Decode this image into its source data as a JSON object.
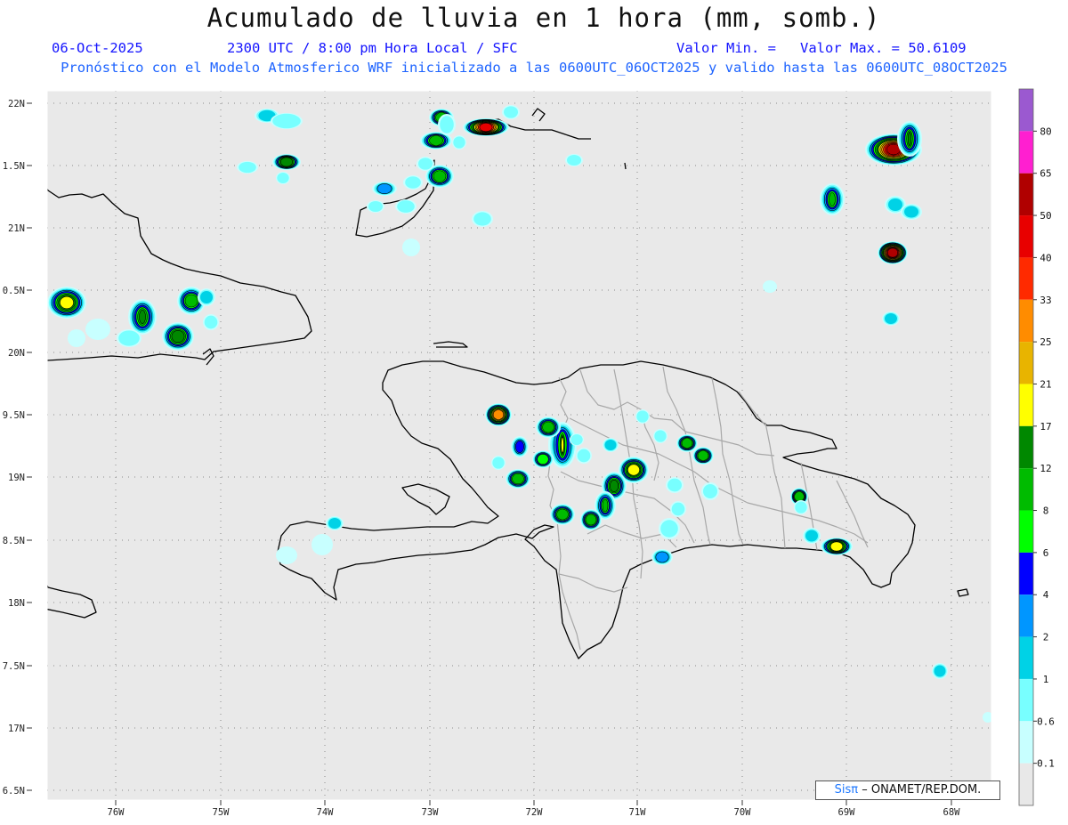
{
  "header": {
    "title": "Acumulado de lluvia en 1 hora (mm, somb.)",
    "date": "06-Oct-2025",
    "time_line": "2300 UTC / 8:00 pm Hora Local / SFC",
    "valor_min": "Valor Min. =",
    "valor_max": "Valor Max. = 50.6109",
    "model_line": "Pronóstico con el Modelo Atmosferico WRF inicializado a las 0600UTC_06OCT2025 y valido hasta las  0600UTC_08OCT2025"
  },
  "axes": {
    "lat_labels": [
      "22N",
      "1.5N",
      "21N",
      "0.5N",
      "20N",
      "9.5N",
      "19N",
      "8.5N",
      "18N",
      "7.5N",
      "17N",
      "6.5N"
    ],
    "lon_labels": [
      "76W",
      "75W",
      "74W",
      "73W",
      "72W",
      "71W",
      "70W",
      "69W",
      "68W"
    ]
  },
  "colorbar": {
    "labels": [
      "80",
      "65",
      "50",
      "40",
      "33",
      "25",
      "21",
      "17",
      "12",
      "8",
      "6",
      "4",
      "2",
      "1",
      "0.6",
      "0.1"
    ],
    "colors": [
      "#9b59d0",
      "#ff1fd0",
      "#b00000",
      "#e80000",
      "#ff2a00",
      "#ff8c00",
      "#e8b400",
      "#ffff00",
      "#008800",
      "#00bb00",
      "#00ff00",
      "#0000ff",
      "#0096ff",
      "#00d2e6",
      "#78ffff",
      "#c8ffff",
      "#e8e8e8"
    ]
  },
  "credit": {
    "sis": "Sisπ",
    "rest": "– ONAMET/REP.DOM."
  },
  "colors": {
    "map_background": "#e9e9e9",
    "title_blue": "#1414ff",
    "model_line_blue": "#1e64ff"
  }
}
